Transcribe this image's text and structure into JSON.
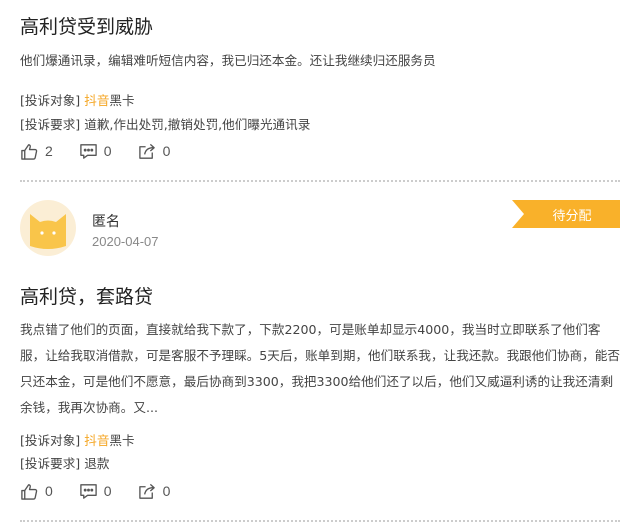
{
  "post1": {
    "title": "高利贷受到威胁",
    "body": "他们爆通讯录，编辑难听短信内容，我已归还本金。还让我继续归还服务员",
    "target_label": "[投诉对象]",
    "target_brand": "抖音",
    "target_rest": "黑卡",
    "demand_label": "[投诉要求]",
    "demand_value": "道歉,作出处罚,撤销处罚,他们曝光通讯录",
    "likes": "2",
    "comments": "0",
    "shares": "0"
  },
  "post2": {
    "author": "匿名",
    "date": "2020-04-07",
    "status": "待分配",
    "title": "高利贷，套路贷",
    "body": "我点错了他们的页面，直接就给我下款了，下款2200，可是账单却显示4000，我当时立即联系了他们客服，让给我取消借款，可是客服不予理睬。5天后，账单到期，他们联系我，让我还款。我跟他们协商，能否只还本金，可是他们不愿意，最后协商到3300，我把3300给他们还了以后，他们又威逼利诱的让我还清剩余钱，我再次协商。又...",
    "target_label": "[投诉对象]",
    "target_brand": "抖音",
    "target_rest": "黑卡",
    "demand_label": "[投诉要求]",
    "demand_value": "退款",
    "likes": "0",
    "comments": "0",
    "shares": "0"
  },
  "colors": {
    "accent": "#f9b12a",
    "brand": "#f5a623"
  },
  "icons": [
    "thumb-up-icon",
    "comment-icon",
    "share-icon",
    "cat-avatar-icon"
  ]
}
